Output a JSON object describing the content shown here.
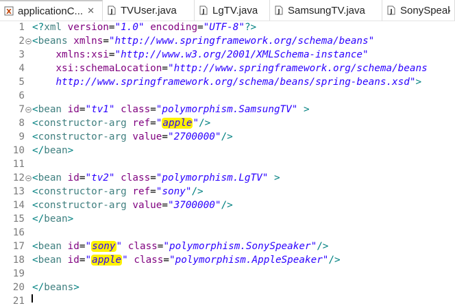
{
  "tabs": [
    {
      "label": "applicationC...",
      "close": "✕",
      "icon": "xml-file-icon",
      "active": true
    },
    {
      "label": "TVUser.java",
      "icon": "java-file-icon",
      "active": false
    },
    {
      "label": "LgTV.java",
      "icon": "java-file-icon",
      "active": false
    },
    {
      "label": "SamsungTV.java",
      "icon": "java-file-icon",
      "active": false
    },
    {
      "label": "SonySpeaker...",
      "icon": "java-file-icon",
      "active": false
    }
  ],
  "lines": [
    {
      "n": "1",
      "fold": false,
      "tokens": [
        [
          "punct",
          "<?"
        ],
        [
          "tag",
          "xml"
        ],
        [
          "plain",
          " "
        ],
        [
          "attr",
          "version"
        ],
        [
          "eq",
          "="
        ],
        [
          "val",
          "\"1.0\""
        ],
        [
          "plain",
          " "
        ],
        [
          "attr",
          "encoding"
        ],
        [
          "eq",
          "="
        ],
        [
          "val",
          "\"UTF-8\""
        ],
        [
          "punct",
          "?>"
        ]
      ]
    },
    {
      "n": "2",
      "fold": true,
      "tokens": [
        [
          "punct",
          "<"
        ],
        [
          "tag",
          "beans"
        ],
        [
          "plain",
          " "
        ],
        [
          "attr",
          "xmlns"
        ],
        [
          "eq",
          "="
        ],
        [
          "val",
          "\"http://www.springframework.org/schema/beans\""
        ]
      ]
    },
    {
      "n": "3",
      "fold": false,
      "tokens": [
        [
          "plain",
          "    "
        ],
        [
          "attr",
          "xmlns:xsi"
        ],
        [
          "eq",
          "="
        ],
        [
          "val",
          "\"http://www.w3.org/2001/XMLSchema-instance\""
        ]
      ]
    },
    {
      "n": "4",
      "fold": false,
      "tokens": [
        [
          "plain",
          "    "
        ],
        [
          "attr",
          "xsi:schemaLocation"
        ],
        [
          "eq",
          "="
        ],
        [
          "val",
          "\"http://www.springframework.org/schema/beans"
        ]
      ]
    },
    {
      "n": "5",
      "fold": false,
      "tokens": [
        [
          "plain",
          "    "
        ],
        [
          "val",
          "http://www.springframework.org/schema/beans/spring-beans.xsd\""
        ],
        [
          "punct",
          ">"
        ]
      ]
    },
    {
      "n": "6",
      "fold": false,
      "tokens": []
    },
    {
      "n": "7",
      "fold": true,
      "tokens": [
        [
          "punct",
          "<"
        ],
        [
          "tag",
          "bean"
        ],
        [
          "plain",
          " "
        ],
        [
          "attr",
          "id"
        ],
        [
          "eq",
          "="
        ],
        [
          "val",
          "\"tv1\""
        ],
        [
          "plain",
          " "
        ],
        [
          "attr",
          "class"
        ],
        [
          "eq",
          "="
        ],
        [
          "val",
          "\"polymorphism.SamsungTV\""
        ],
        [
          "plain",
          " "
        ],
        [
          "punct",
          ">"
        ]
      ]
    },
    {
      "n": "8",
      "fold": false,
      "tokens": [
        [
          "punct",
          "<"
        ],
        [
          "tag",
          "constructor-arg"
        ],
        [
          "plain",
          " "
        ],
        [
          "attr",
          "ref"
        ],
        [
          "eq",
          "="
        ],
        [
          "val",
          "\""
        ],
        [
          "valhl",
          "apple"
        ],
        [
          "val",
          "\""
        ],
        [
          "punct",
          "/>"
        ]
      ]
    },
    {
      "n": "9",
      "fold": false,
      "tokens": [
        [
          "punct",
          "<"
        ],
        [
          "tag",
          "constructor-arg"
        ],
        [
          "plain",
          " "
        ],
        [
          "attr",
          "value"
        ],
        [
          "eq",
          "="
        ],
        [
          "val",
          "\"2700000\""
        ],
        [
          "punct",
          "/>"
        ]
      ]
    },
    {
      "n": "10",
      "fold": false,
      "tokens": [
        [
          "punct",
          "</"
        ],
        [
          "tag",
          "bean"
        ],
        [
          "punct",
          ">"
        ]
      ]
    },
    {
      "n": "11",
      "fold": false,
      "tokens": []
    },
    {
      "n": "12",
      "fold": true,
      "tokens": [
        [
          "punct",
          "<"
        ],
        [
          "tag",
          "bean"
        ],
        [
          "plain",
          " "
        ],
        [
          "attr",
          "id"
        ],
        [
          "eq",
          "="
        ],
        [
          "val",
          "\"tv2\""
        ],
        [
          "plain",
          " "
        ],
        [
          "attr",
          "class"
        ],
        [
          "eq",
          "="
        ],
        [
          "val",
          "\"polymorphism.LgTV\""
        ],
        [
          "plain",
          " "
        ],
        [
          "punct",
          ">"
        ]
      ]
    },
    {
      "n": "13",
      "fold": false,
      "tokens": [
        [
          "punct",
          "<"
        ],
        [
          "tag",
          "constructor-arg"
        ],
        [
          "plain",
          " "
        ],
        [
          "attr",
          "ref"
        ],
        [
          "eq",
          "="
        ],
        [
          "val",
          "\"sony\""
        ],
        [
          "punct",
          "/>"
        ]
      ]
    },
    {
      "n": "14",
      "fold": false,
      "tokens": [
        [
          "punct",
          "<"
        ],
        [
          "tag",
          "constructor-arg"
        ],
        [
          "plain",
          " "
        ],
        [
          "attr",
          "value"
        ],
        [
          "eq",
          "="
        ],
        [
          "val",
          "\"3700000\""
        ],
        [
          "punct",
          "/>"
        ]
      ]
    },
    {
      "n": "15",
      "fold": false,
      "tokens": [
        [
          "punct",
          "</"
        ],
        [
          "tag",
          "bean"
        ],
        [
          "punct",
          ">"
        ]
      ]
    },
    {
      "n": "16",
      "fold": false,
      "tokens": []
    },
    {
      "n": "17",
      "fold": false,
      "tokens": [
        [
          "punct",
          "<"
        ],
        [
          "tag",
          "bean"
        ],
        [
          "plain",
          " "
        ],
        [
          "attr",
          "id"
        ],
        [
          "eq",
          "="
        ],
        [
          "val",
          "\""
        ],
        [
          "valhl",
          "sony"
        ],
        [
          "val",
          "\""
        ],
        [
          "plain",
          " "
        ],
        [
          "attr",
          "class"
        ],
        [
          "eq",
          "="
        ],
        [
          "val",
          "\"polymorphism.SonySpeaker\""
        ],
        [
          "punct",
          "/>"
        ]
      ]
    },
    {
      "n": "18",
      "fold": false,
      "tokens": [
        [
          "punct",
          "<"
        ],
        [
          "tag",
          "bean"
        ],
        [
          "plain",
          " "
        ],
        [
          "attr",
          "id"
        ],
        [
          "eq",
          "="
        ],
        [
          "val",
          "\""
        ],
        [
          "valhl",
          "apple"
        ],
        [
          "val",
          "\""
        ],
        [
          "plain",
          " "
        ],
        [
          "attr",
          "class"
        ],
        [
          "eq",
          "="
        ],
        [
          "val",
          "\"polymorphism.AppleSpeaker\""
        ],
        [
          "punct",
          "/>"
        ]
      ]
    },
    {
      "n": "19",
      "fold": false,
      "tokens": []
    },
    {
      "n": "20",
      "fold": false,
      "tokens": [
        [
          "punct",
          "</"
        ],
        [
          "tag",
          "beans"
        ],
        [
          "punct",
          ">"
        ]
      ]
    },
    {
      "n": "21",
      "fold": false,
      "tokens": []
    }
  ],
  "colors": {
    "punct": "#008080",
    "tag": "#3f7f7f",
    "attr": "#7f007f",
    "val": "#2a00ff",
    "highlight": "#fff200"
  }
}
